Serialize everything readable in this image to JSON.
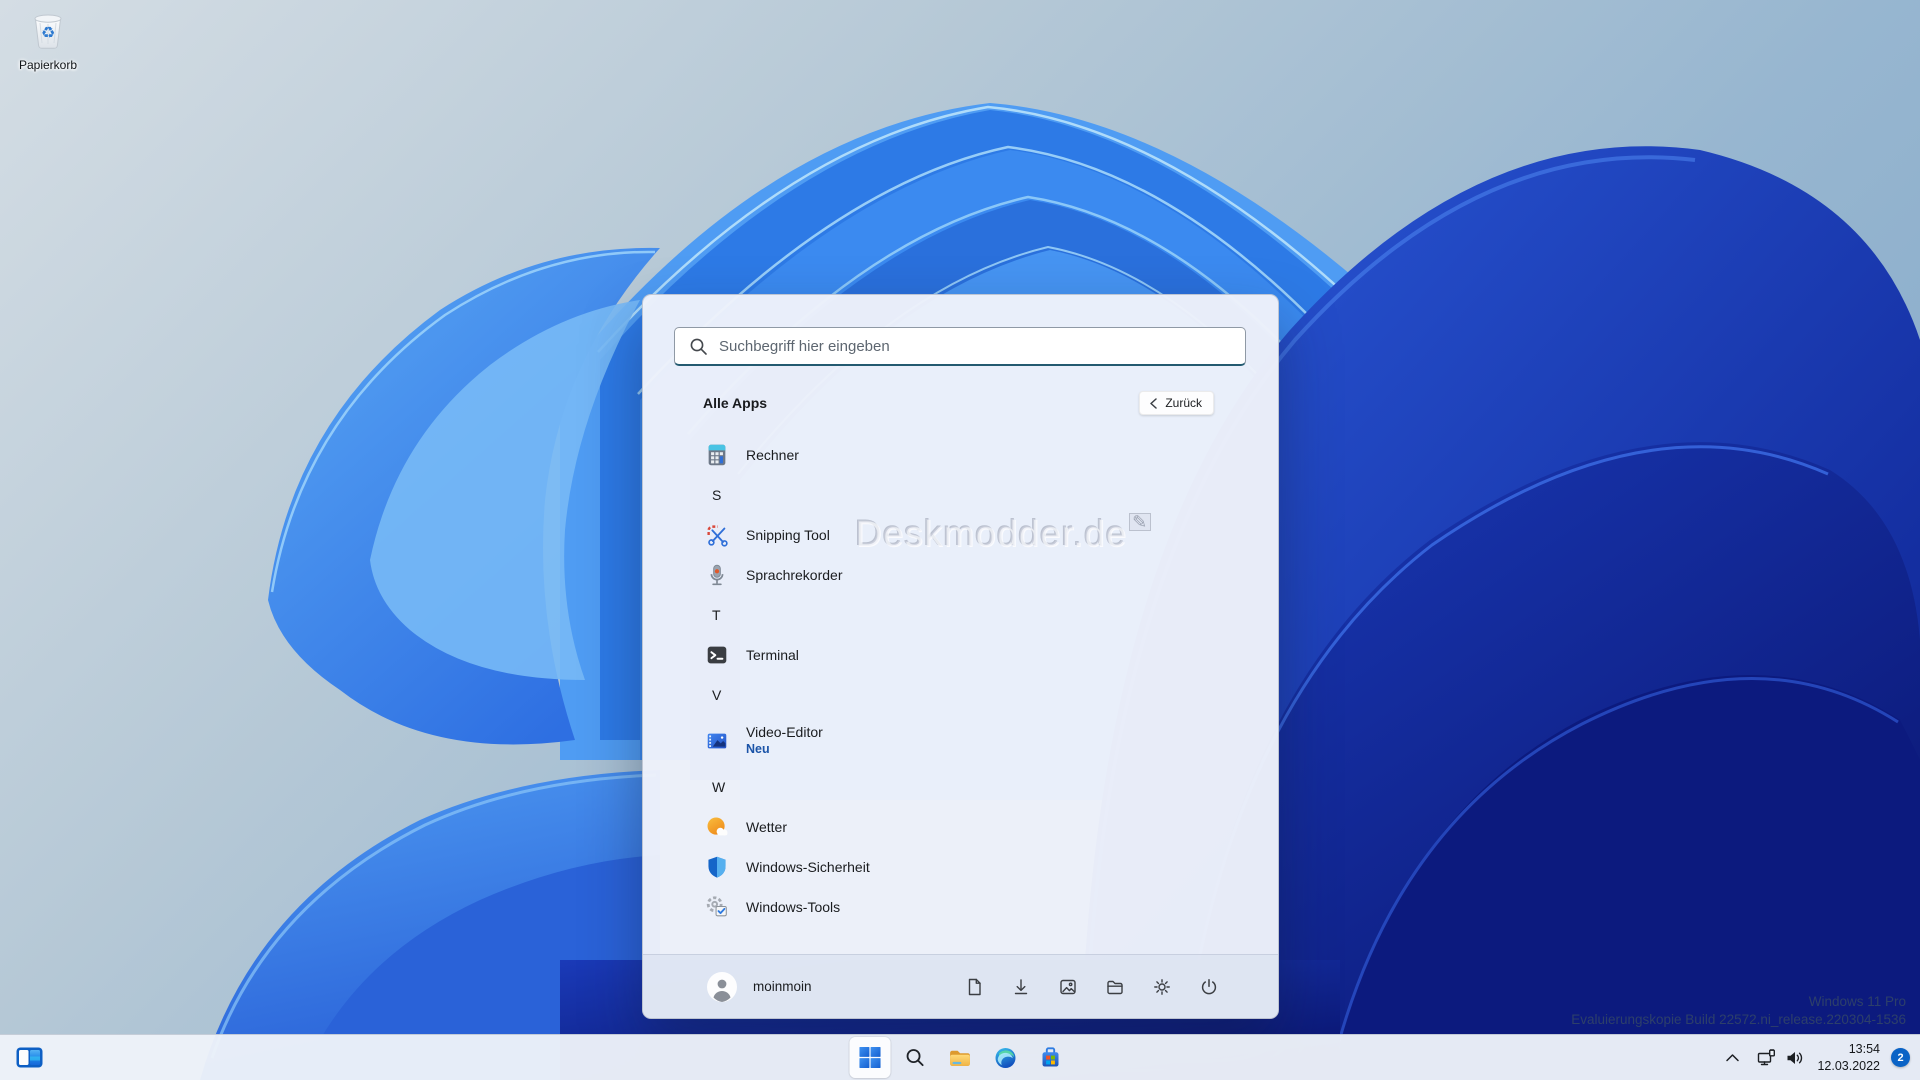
{
  "desktop": {
    "recycle_bin": {
      "label": "Papierkorb"
    },
    "center_watermark": "Deskmodder.de",
    "build_watermark": {
      "line1": "Windows 11 Pro",
      "line2": "Evaluierungskopie Build 22572.ni_release.220304-1536"
    }
  },
  "start_menu": {
    "search_placeholder": "Suchbegriff hier eingeben",
    "section_title": "Alle Apps",
    "back_label": "Zurück",
    "list": [
      {
        "type": "app",
        "label": "Rechner",
        "icon": "calculator-icon"
      },
      {
        "type": "letter",
        "label": "S"
      },
      {
        "type": "app",
        "label": "Snipping Tool",
        "icon": "snipping-tool-icon"
      },
      {
        "type": "app",
        "label": "Sprachrekorder",
        "icon": "voice-recorder-icon"
      },
      {
        "type": "letter",
        "label": "T"
      },
      {
        "type": "app",
        "label": "Terminal",
        "icon": "terminal-icon"
      },
      {
        "type": "letter",
        "label": "V"
      },
      {
        "type": "app",
        "label": "Video-Editor",
        "icon": "video-editor-icon",
        "badge": "Neu"
      },
      {
        "type": "letter",
        "label": "W"
      },
      {
        "type": "app",
        "label": "Wetter",
        "icon": "weather-icon"
      },
      {
        "type": "app",
        "label": "Windows-Sicherheit",
        "icon": "security-shield-icon"
      },
      {
        "type": "app",
        "label": "Windows-Tools",
        "icon": "windows-tools-icon"
      }
    ],
    "user": "moinmoin",
    "footer_icons": [
      "documents",
      "downloads",
      "pictures",
      "file-explorer",
      "settings",
      "power"
    ]
  },
  "taskbar": {
    "buttons": [
      "widgets",
      "start",
      "search",
      "file-explorer",
      "edge",
      "store"
    ],
    "tray": {
      "time": "13:54",
      "date": "12.03.2022",
      "notification_count": "2"
    }
  },
  "colors": {
    "accent": "#0a63c6",
    "search_underline": "#235a70",
    "neu_badge": "#1b54a8"
  }
}
